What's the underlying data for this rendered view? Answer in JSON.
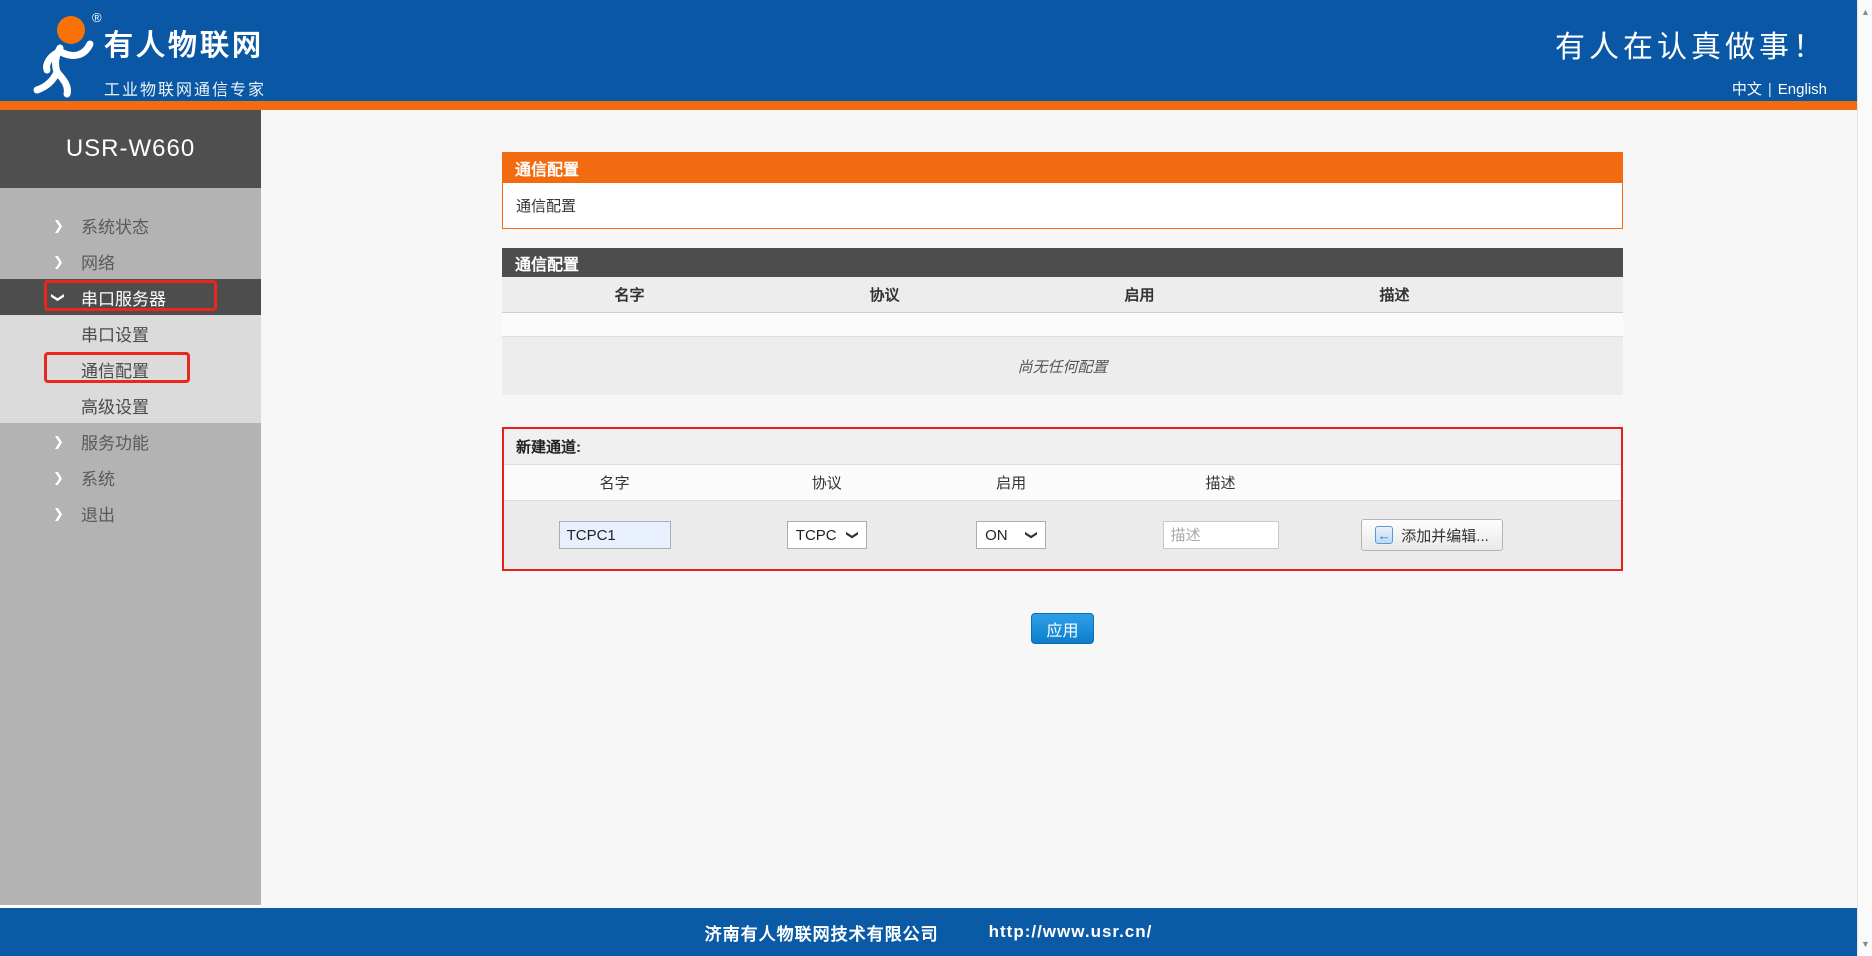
{
  "header": {
    "brand": "有人物联网",
    "brand_subtitle": "工业物联网通信专家",
    "registered_mark": "®",
    "slogan": "有人在认真做事！",
    "lang_zh": "中文",
    "lang_sep": "|",
    "lang_en": "English"
  },
  "sidebar": {
    "device": "USR-W660",
    "items": [
      {
        "label": "系统状态"
      },
      {
        "label": "网络"
      },
      {
        "label": "串口服务器"
      },
      {
        "label": "串口设置"
      },
      {
        "label": "通信配置"
      },
      {
        "label": "高级设置"
      },
      {
        "label": "服务功能"
      },
      {
        "label": "系统"
      },
      {
        "label": "退出"
      }
    ]
  },
  "main": {
    "page_header": {
      "title": "通信配置",
      "subtitle": "通信配置"
    },
    "config_table": {
      "title": "通信配置",
      "columns": [
        "名字",
        "协议",
        "启用",
        "描述"
      ],
      "empty_message": "尚无任何配置"
    },
    "new_channel": {
      "title": "新建通道:",
      "columns": [
        "名字",
        "协议",
        "启用",
        "描述"
      ],
      "name_value": "TCPC1",
      "protocol_value": "TCPC",
      "enable_value": "ON",
      "desc_placeholder": "描述",
      "add_button_label": "添加并编辑..."
    },
    "apply_button_label": "应用"
  },
  "footer": {
    "company": "济南有人物联网技术有限公司",
    "url": "http://www.usr.cn/"
  },
  "icons": {
    "chevron": "❯",
    "select_arrow": "❯",
    "add_edit_arrow": "←",
    "scroll_up": "▲",
    "scroll_down": "▼"
  },
  "colors": {
    "header_blue": "#0a58a5",
    "accent_orange": "#f26b11",
    "highlight_red": "#e8281e",
    "panel_dark_gray": "#4d4d4d",
    "sidebar_gray": "#b3b3b3",
    "apply_blue": "#0d7ecb",
    "autofill_input_blue": "#e8f0fe"
  }
}
